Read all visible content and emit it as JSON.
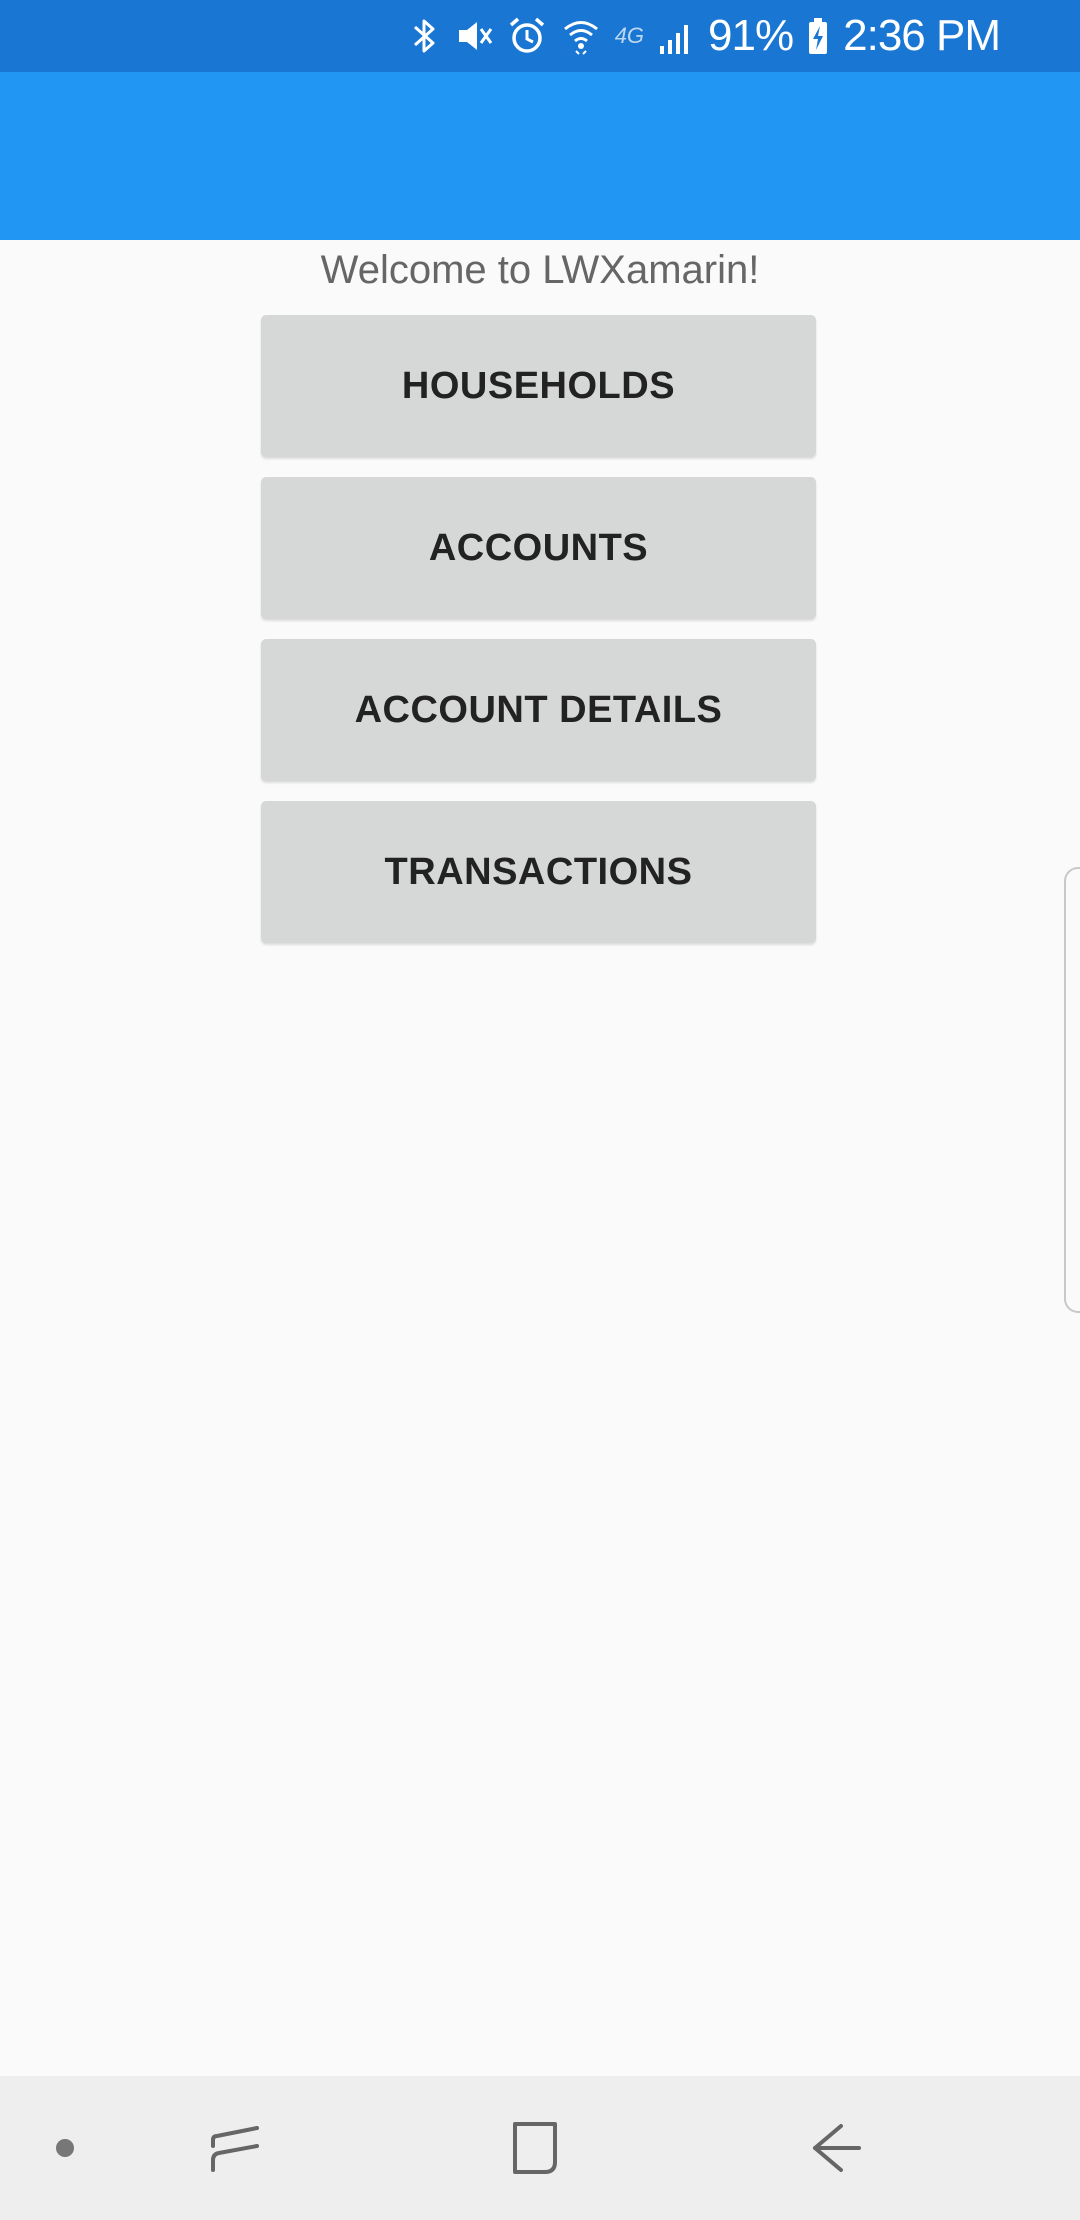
{
  "status_bar": {
    "battery_percent": "91%",
    "time": "2:36 PM",
    "icons": [
      "bluetooth-icon",
      "vibrate-mute-icon",
      "alarm-icon",
      "wifi-icon",
      "lte-icon",
      "signal-icon",
      "battery-charging-icon"
    ],
    "lte_label": "4G",
    "background": "#1976d2"
  },
  "app_bar": {
    "background": "#2196f3"
  },
  "main": {
    "welcome": "Welcome to LWXamarin!",
    "buttons": [
      {
        "label": "HOUSEHOLDS"
      },
      {
        "label": "ACCOUNTS"
      },
      {
        "label": "ACCOUNT DETAILS"
      },
      {
        "label": "TRANSACTIONS"
      }
    ]
  },
  "nav_bar": {
    "items": [
      "dot-icon",
      "recents-icon",
      "home-icon",
      "back-icon"
    ]
  }
}
